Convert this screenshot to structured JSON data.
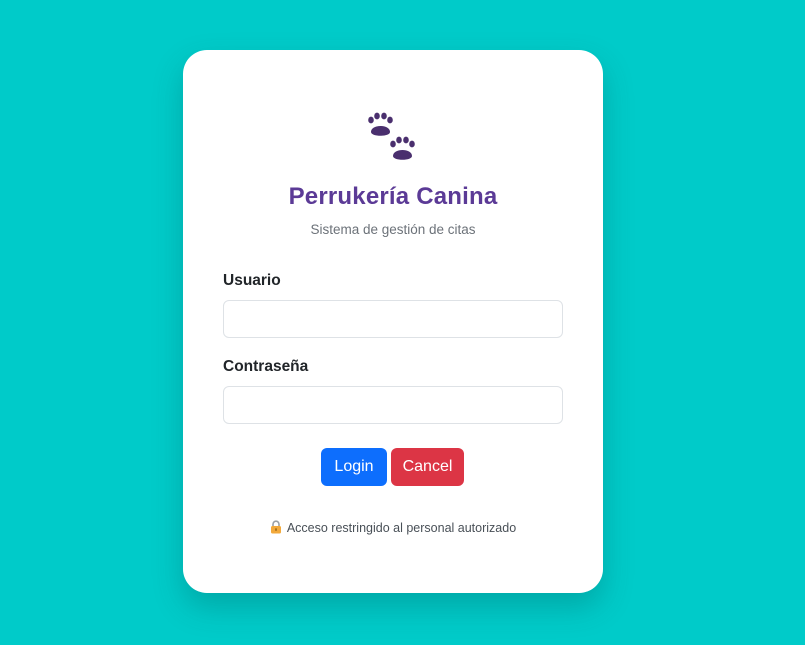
{
  "app": {
    "title": "Perrukería Canina",
    "subtitle": "Sistema de gestión de citas",
    "logo_icon": "paw-prints-icon"
  },
  "form": {
    "username_label": "Usuario",
    "username_value": "",
    "password_label": "Contraseña",
    "password_value": ""
  },
  "buttons": {
    "login_label": "Login",
    "cancel_label": "Cancel"
  },
  "notice": {
    "icon": "lock-icon",
    "text": "Acceso restringido al personal autorizado"
  },
  "colors": {
    "background": "#00cbc9",
    "title": "#5b3a96",
    "login": "#0d6efd",
    "cancel": "#dc3545"
  }
}
